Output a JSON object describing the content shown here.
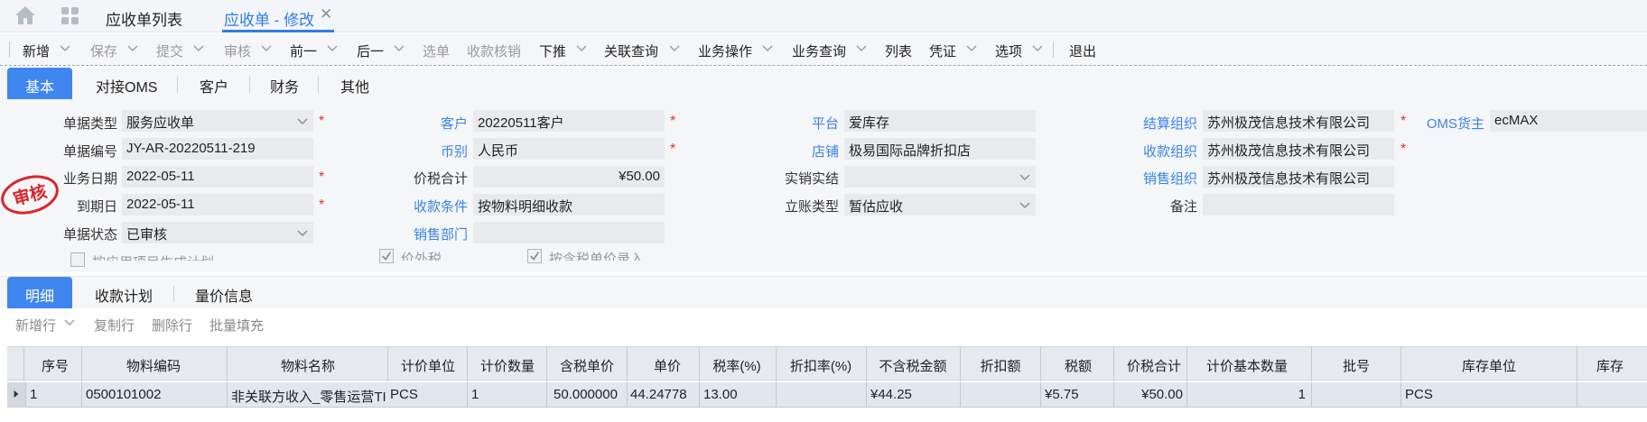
{
  "topnav": {
    "tabs": [
      {
        "label": "应收单列表"
      },
      {
        "label": "应收单 - 修改"
      }
    ]
  },
  "toolbar": {
    "items": [
      {
        "label": "新增",
        "enabled": true
      },
      {
        "label": "保存",
        "enabled": false
      },
      {
        "label": "提交",
        "enabled": false
      },
      {
        "label": "审核",
        "enabled": false
      },
      {
        "label": "前一",
        "enabled": true
      },
      {
        "label": "后一",
        "enabled": true
      },
      {
        "label": "选单",
        "enabled": false
      },
      {
        "label": "收款核销",
        "enabled": false
      },
      {
        "label": "下推",
        "enabled": true
      },
      {
        "label": "关联查询",
        "enabled": true
      },
      {
        "label": "业务操作",
        "enabled": true
      },
      {
        "label": "业务查询",
        "enabled": true
      },
      {
        "label": "列表",
        "enabled": true
      },
      {
        "label": "凭证",
        "enabled": true
      },
      {
        "label": "选项",
        "enabled": true
      },
      {
        "label": "退出",
        "enabled": true
      }
    ]
  },
  "section_tabs": [
    "基本",
    "对接OMS",
    "客户",
    "财务",
    "其他"
  ],
  "form": {
    "doc_type_label": "单据类型",
    "doc_type": "服务应收单",
    "doc_no_label": "单据编号",
    "doc_no": "JY-AR-20220511-219",
    "biz_date_label": "业务日期",
    "biz_date": "2022-05-11",
    "due_date_label": "到期日",
    "due_date": "2022-05-11",
    "status_label": "单据状态",
    "status": "已审核",
    "customer_label": "客户",
    "customer": "20220511客户",
    "currency_label": "币别",
    "currency": "人民币",
    "total_label": "价税合计",
    "total": "¥50.00",
    "terms_label": "收款条件",
    "terms": "按物料明细收款",
    "sales_dept_label": "销售部门",
    "sales_dept": "",
    "platform_label": "平台",
    "platform": "爱库存",
    "shop_label": "店铺",
    "shop": "极易国际品牌折扣店",
    "settle_label": "实销实结",
    "settle": "",
    "account_type_label": "立账类型",
    "account_type": "暂估应收",
    "settle_org_label": "结算组织",
    "settle_org": "苏州极茂信息技术有限公司",
    "receive_org_label": "收款组织",
    "receive_org": "苏州极茂信息技术有限公司",
    "sales_org_label": "销售组织",
    "sales_org": "苏州极茂信息技术有限公司",
    "remark_label": "备注",
    "remark": "",
    "oms_owner_label": "OMS货主",
    "oms_owner": "ecMAX",
    "chk1_label": "按应用项目生成计划",
    "chk2_label": "价外税",
    "chk3_label": "按含税单价录入",
    "stamp_text": "审核"
  },
  "detail_tabs": [
    "明细",
    "收款计划",
    "量价信息"
  ],
  "subtoolbar": [
    "新增行",
    "复制行",
    "删除行",
    "批量填充"
  ],
  "grid": {
    "columns": [
      "序号",
      "物料编码",
      "物料名称",
      "计价单位",
      "计价数量",
      "含税单价",
      "单价",
      "税率(%)",
      "折扣率(%)",
      "不含税金额",
      "折扣额",
      "税额",
      "价税合计",
      "计价基本数量",
      "批号",
      "库存单位",
      "库存"
    ],
    "rows": [
      [
        "1",
        "0500101002",
        "非关联方收入_零售运营TI",
        "PCS",
        "1",
        "50.000000",
        "44.24778",
        "13.00",
        "",
        "¥44.25",
        "",
        "¥5.75",
        "¥50.00",
        "1",
        "",
        "PCS",
        ""
      ]
    ]
  },
  "colors": {
    "accent": "#3f86f0",
    "link": "#3a84e8",
    "required": "#e03030",
    "stamp": "#d9262b"
  }
}
